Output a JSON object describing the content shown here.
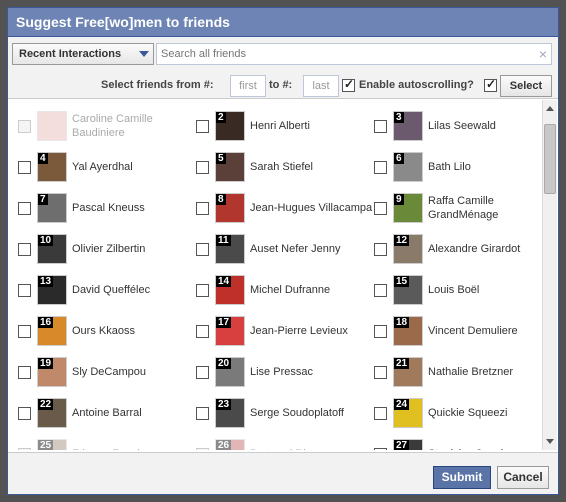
{
  "dialog": {
    "title": "Suggest Free[wo]men to friends"
  },
  "controls": {
    "filter_selected": "Recent Interactions",
    "search_placeholder": "Search all friends",
    "clear_icon": "×",
    "select_from_label": "Select friends from #:",
    "first_placeholder": "first",
    "to_label": "to #:",
    "last_placeholder": "last",
    "autoscroll_label": "Enable autoscrolling?",
    "autoscroll_checked": true,
    "select_button": "Select"
  },
  "friends": [
    {
      "num": "",
      "name": "Caroline Camille Baudiniere",
      "disabled": true,
      "color": "#e8b4b4"
    },
    {
      "num": "2",
      "name": "Henri Alberti",
      "disabled": false,
      "color": "#3a2a24"
    },
    {
      "num": "3",
      "name": "Lilas Seewald",
      "disabled": false,
      "color": "#6b5a6e"
    },
    {
      "num": "4",
      "name": "Yal Ayerdhal",
      "disabled": false,
      "color": "#7a5a3a"
    },
    {
      "num": "5",
      "name": "Sarah Stiefel",
      "disabled": false,
      "color": "#5a4038"
    },
    {
      "num": "6",
      "name": "Bath Lilo",
      "disabled": false,
      "color": "#8a8a8a"
    },
    {
      "num": "7",
      "name": "Pascal Kneuss",
      "disabled": false,
      "color": "#6e6e6e"
    },
    {
      "num": "8",
      "name": "Jean-Hugues Villacampa",
      "disabled": false,
      "color": "#b0362e"
    },
    {
      "num": "9",
      "name": "Raffa Camille GrandMénage",
      "disabled": false,
      "color": "#6a8a3a"
    },
    {
      "num": "10",
      "name": "Olivier Zilbertin",
      "disabled": false,
      "color": "#3a3a3a"
    },
    {
      "num": "11",
      "name": "Auset Nefer Jenny",
      "disabled": false,
      "color": "#4a4a4a"
    },
    {
      "num": "12",
      "name": "Alexandre Girardot",
      "disabled": false,
      "color": "#8a7a6a"
    },
    {
      "num": "13",
      "name": "David Queffélec",
      "disabled": false,
      "color": "#2a2a2a"
    },
    {
      "num": "14",
      "name": "Michel Dufranne",
      "disabled": false,
      "color": "#c0302a"
    },
    {
      "num": "15",
      "name": "Louis Boël",
      "disabled": false,
      "color": "#5a5a5a"
    },
    {
      "num": "16",
      "name": "Ours Kkaoss",
      "disabled": false,
      "color": "#d88a2a"
    },
    {
      "num": "17",
      "name": "Jean-Pierre Levieux",
      "disabled": false,
      "color": "#d84040"
    },
    {
      "num": "18",
      "name": "Vincent Demuliere",
      "disabled": false,
      "color": "#9a6a4a"
    },
    {
      "num": "19",
      "name": "Sly DeCampou",
      "disabled": false,
      "color": "#c08a6a"
    },
    {
      "num": "20",
      "name": "Lise Pressac",
      "disabled": false,
      "color": "#7a7a7a"
    },
    {
      "num": "21",
      "name": "Nathalie Bretzner",
      "disabled": false,
      "color": "#a07a5a"
    },
    {
      "num": "22",
      "name": "Antoine Barral",
      "disabled": false,
      "color": "#6a5a4a"
    },
    {
      "num": "23",
      "name": "Serge Soudoplatoff",
      "disabled": false,
      "color": "#4a4a4a"
    },
    {
      "num": "24",
      "name": "Quickie Squeezi",
      "disabled": false,
      "color": "#e0c020"
    },
    {
      "num": "25",
      "name": "Etienne Zoupic",
      "disabled": true,
      "color": "#9a8a7a"
    },
    {
      "num": "26",
      "name": "Bertrand Rio",
      "disabled": true,
      "color": "#c06060"
    },
    {
      "num": "27",
      "name": "Stanislas Jourdan",
      "disabled": false,
      "color": "#3a3a3a"
    }
  ],
  "footer": {
    "submit_label": "Submit",
    "cancel_label": "Cancel"
  }
}
